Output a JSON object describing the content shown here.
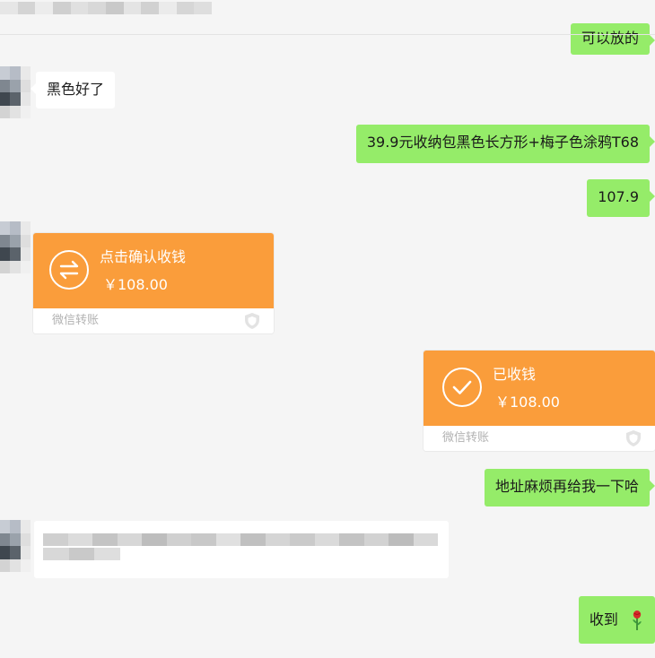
{
  "messages": {
    "partial_top": "可以放的",
    "left_1": "黑色好了",
    "right_1": "39.9元收纳包黑色长方形+梅子色涂鸦T68",
    "right_2": "107.9",
    "right_3": "地址麻烦再给我一下哈",
    "right_4": "收到"
  },
  "transfer_incoming": {
    "title": "点击确认收钱",
    "amount": "￥108.00",
    "label": "微信转账",
    "icon": "transfer-arrows-icon"
  },
  "transfer_received": {
    "title": "已收钱",
    "amount": "￥108.00",
    "label": "微信转账",
    "icon": "checkmark-icon"
  },
  "emoji": {
    "rose": "rose-icon"
  },
  "colors": {
    "background": "#f5f5f5",
    "sent_bubble": "#95ec69",
    "received_bubble": "#ffffff",
    "transfer_orange": "#fa9d3b",
    "transfer_label": "#b2b2b2"
  }
}
